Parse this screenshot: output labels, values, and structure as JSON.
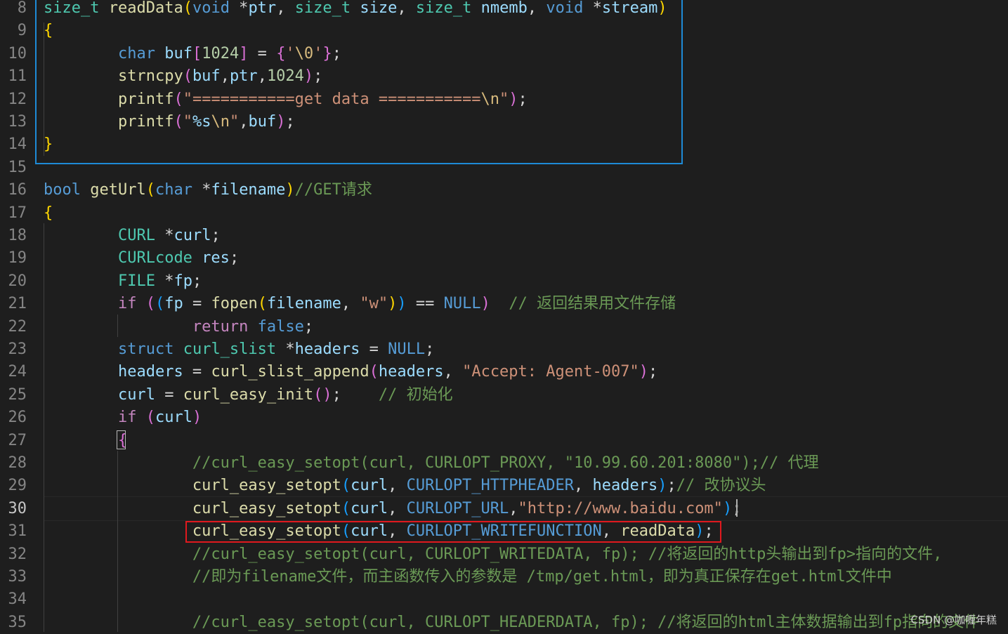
{
  "editor": {
    "active_line": "30",
    "lines": [
      {
        "n": "8",
        "tokens": [
          [
            "size_t",
            "ty"
          ],
          [
            " ",
            "pl"
          ],
          [
            "readData",
            "fn"
          ],
          [
            "(",
            "b1"
          ],
          [
            "void",
            "kw"
          ],
          [
            " *",
            "pl"
          ],
          [
            "ptr",
            "va"
          ],
          [
            ", ",
            "pl"
          ],
          [
            "size_t",
            "ty"
          ],
          [
            " ",
            "pl"
          ],
          [
            "size",
            "va"
          ],
          [
            ", ",
            "pl"
          ],
          [
            "size_t",
            "ty"
          ],
          [
            " ",
            "pl"
          ],
          [
            "nmemb",
            "va"
          ],
          [
            ", ",
            "pl"
          ],
          [
            "void",
            "kw"
          ],
          [
            " *",
            "pl"
          ],
          [
            "stream",
            "va"
          ],
          [
            ")",
            "b1"
          ]
        ]
      },
      {
        "n": "9",
        "tokens": [
          [
            "{",
            "b1"
          ]
        ]
      },
      {
        "n": "10",
        "tokens": [
          [
            "        ",
            "pl"
          ],
          [
            "char",
            "kw"
          ],
          [
            " ",
            "pl"
          ],
          [
            "buf",
            "va"
          ],
          [
            "[",
            "b2"
          ],
          [
            "1024",
            "nu"
          ],
          [
            "]",
            "b2"
          ],
          [
            " = ",
            "pl"
          ],
          [
            "{",
            "b2"
          ],
          [
            "'",
            "st"
          ],
          [
            "\\0",
            "es"
          ],
          [
            "'",
            "st"
          ],
          [
            "}",
            "b2"
          ],
          [
            ";",
            "pl"
          ]
        ]
      },
      {
        "n": "11",
        "tokens": [
          [
            "        ",
            "pl"
          ],
          [
            "strncpy",
            "fn"
          ],
          [
            "(",
            "b2"
          ],
          [
            "buf",
            "va"
          ],
          [
            ",",
            "pl"
          ],
          [
            "ptr",
            "va"
          ],
          [
            ",",
            "pl"
          ],
          [
            "1024",
            "nu"
          ],
          [
            ")",
            "b2"
          ],
          [
            ";",
            "pl"
          ]
        ]
      },
      {
        "n": "12",
        "tokens": [
          [
            "        ",
            "pl"
          ],
          [
            "printf",
            "fn"
          ],
          [
            "(",
            "b2"
          ],
          [
            "\"===========get data ===========",
            "st"
          ],
          [
            "\\n",
            "es"
          ],
          [
            "\"",
            "st"
          ],
          [
            ")",
            "b2"
          ],
          [
            ";",
            "pl"
          ]
        ]
      },
      {
        "n": "13",
        "tokens": [
          [
            "        ",
            "pl"
          ],
          [
            "printf",
            "fn"
          ],
          [
            "(",
            "b2"
          ],
          [
            "\"",
            "st"
          ],
          [
            "%s",
            "va"
          ],
          [
            "\\n",
            "es"
          ],
          [
            "\"",
            "st"
          ],
          [
            ",",
            "pl"
          ],
          [
            "buf",
            "va"
          ],
          [
            ")",
            "b2"
          ],
          [
            ";",
            "pl"
          ]
        ]
      },
      {
        "n": "14",
        "tokens": [
          [
            "}",
            "b1"
          ]
        ]
      },
      {
        "n": "15",
        "tokens": []
      },
      {
        "n": "16",
        "tokens": [
          [
            "bool",
            "kw"
          ],
          [
            " ",
            "pl"
          ],
          [
            "getUrl",
            "fn"
          ],
          [
            "(",
            "b1"
          ],
          [
            "char",
            "kw"
          ],
          [
            " *",
            "pl"
          ],
          [
            "filename",
            "va"
          ],
          [
            ")",
            "b1"
          ],
          [
            "//GET请求",
            "cm"
          ]
        ]
      },
      {
        "n": "17",
        "tokens": [
          [
            "{",
            "b1"
          ]
        ]
      },
      {
        "n": "18",
        "tokens": [
          [
            "        ",
            "pl"
          ],
          [
            "CURL",
            "ty"
          ],
          [
            " *",
            "pl"
          ],
          [
            "curl",
            "va"
          ],
          [
            ";",
            "pl"
          ]
        ]
      },
      {
        "n": "19",
        "tokens": [
          [
            "        ",
            "pl"
          ],
          [
            "CURLcode",
            "ty"
          ],
          [
            " ",
            "pl"
          ],
          [
            "res",
            "va"
          ],
          [
            ";",
            "pl"
          ]
        ]
      },
      {
        "n": "20",
        "tokens": [
          [
            "        ",
            "pl"
          ],
          [
            "FILE",
            "ty"
          ],
          [
            " *",
            "pl"
          ],
          [
            "fp",
            "va"
          ],
          [
            ";",
            "pl"
          ]
        ]
      },
      {
        "n": "21",
        "tokens": [
          [
            "        ",
            "pl"
          ],
          [
            "if",
            "ctl"
          ],
          [
            " ",
            "pl"
          ],
          [
            "(",
            "b2"
          ],
          [
            "(",
            "b3"
          ],
          [
            "fp",
            "va"
          ],
          [
            " = ",
            "pl"
          ],
          [
            "fopen",
            "fn"
          ],
          [
            "(",
            "b1"
          ],
          [
            "filename",
            "va"
          ],
          [
            ", ",
            "pl"
          ],
          [
            "\"w\"",
            "st"
          ],
          [
            ")",
            "b1"
          ],
          [
            ")",
            "b3"
          ],
          [
            " == ",
            "pl"
          ],
          [
            "NULL",
            "ma"
          ],
          [
            ")",
            "b2"
          ],
          [
            "  ",
            "pl"
          ],
          [
            "// 返回结果用文件存储",
            "cm"
          ]
        ]
      },
      {
        "n": "22",
        "tokens": [
          [
            "                ",
            "pl"
          ],
          [
            "return",
            "ctl"
          ],
          [
            " ",
            "pl"
          ],
          [
            "false",
            "kw"
          ],
          [
            ";",
            "pl"
          ]
        ]
      },
      {
        "n": "23",
        "tokens": [
          [
            "        ",
            "pl"
          ],
          [
            "struct",
            "kw"
          ],
          [
            " ",
            "pl"
          ],
          [
            "curl_slist",
            "ty"
          ],
          [
            " *",
            "pl"
          ],
          [
            "headers",
            "va"
          ],
          [
            " = ",
            "pl"
          ],
          [
            "NULL",
            "ma"
          ],
          [
            ";",
            "pl"
          ]
        ]
      },
      {
        "n": "24",
        "tokens": [
          [
            "        ",
            "pl"
          ],
          [
            "headers",
            "va"
          ],
          [
            " = ",
            "pl"
          ],
          [
            "curl_slist_append",
            "fn"
          ],
          [
            "(",
            "b2"
          ],
          [
            "headers",
            "va"
          ],
          [
            ", ",
            "pl"
          ],
          [
            "\"Accept: Agent-007\"",
            "st"
          ],
          [
            ")",
            "b2"
          ],
          [
            ";",
            "pl"
          ]
        ]
      },
      {
        "n": "25",
        "tokens": [
          [
            "        ",
            "pl"
          ],
          [
            "curl",
            "va"
          ],
          [
            " = ",
            "pl"
          ],
          [
            "curl_easy_init",
            "fn"
          ],
          [
            "(",
            "b2"
          ],
          [
            ")",
            "b2"
          ],
          [
            ";",
            "pl"
          ],
          [
            "    ",
            "pl"
          ],
          [
            "// 初始化",
            "cm"
          ]
        ]
      },
      {
        "n": "26",
        "tokens": [
          [
            "        ",
            "pl"
          ],
          [
            "if",
            "ctl"
          ],
          [
            " ",
            "pl"
          ],
          [
            "(",
            "b2"
          ],
          [
            "curl",
            "va"
          ],
          [
            ")",
            "b2"
          ]
        ]
      },
      {
        "n": "27",
        "tokens": [
          [
            "        ",
            "pl"
          ],
          [
            "{",
            "b2"
          ]
        ]
      },
      {
        "n": "28",
        "tokens": [
          [
            "                ",
            "pl"
          ],
          [
            "//curl_easy_setopt(curl, CURLOPT_PROXY, \"10.99.60.201:8080\");// 代理",
            "cm"
          ]
        ]
      },
      {
        "n": "29",
        "tokens": [
          [
            "                ",
            "pl"
          ],
          [
            "curl_easy_setopt",
            "fn"
          ],
          [
            "(",
            "b3"
          ],
          [
            "curl",
            "va"
          ],
          [
            ", ",
            "pl"
          ],
          [
            "CURLOPT_HTTPHEADER",
            "ma"
          ],
          [
            ", ",
            "pl"
          ],
          [
            "headers",
            "va"
          ],
          [
            ")",
            "b3"
          ],
          [
            ";",
            "pl"
          ],
          [
            "// 改协议头",
            "cm"
          ]
        ]
      },
      {
        "n": "30",
        "tokens": [
          [
            "                ",
            "pl"
          ],
          [
            "curl_easy_setopt",
            "fn"
          ],
          [
            "(",
            "b3"
          ],
          [
            "curl",
            "va"
          ],
          [
            ", ",
            "pl"
          ],
          [
            "CURLOPT_URL",
            "ma"
          ],
          [
            ",",
            "pl"
          ],
          [
            "\"http://www.baidu.com\"",
            "st"
          ],
          [
            ")",
            "b3"
          ],
          [
            ";",
            "pl"
          ]
        ]
      },
      {
        "n": "31",
        "tokens": [
          [
            "                ",
            "pl"
          ],
          [
            "curl_easy_setopt",
            "fn"
          ],
          [
            "(",
            "b3"
          ],
          [
            "curl",
            "va"
          ],
          [
            ", ",
            "pl"
          ],
          [
            "CURLOPT_WRITEFUNCTION",
            "ma"
          ],
          [
            ", ",
            "pl"
          ],
          [
            "readData",
            "fn"
          ],
          [
            ")",
            "b3"
          ],
          [
            ";",
            "pl"
          ]
        ]
      },
      {
        "n": "32",
        "tokens": [
          [
            "                ",
            "pl"
          ],
          [
            "//curl_easy_setopt(curl, CURLOPT_WRITEDATA, fp); //将返回的http头输出到fp>指向的文件,",
            "cm"
          ]
        ]
      },
      {
        "n": "33",
        "tokens": [
          [
            "                ",
            "pl"
          ],
          [
            "//即为filename文件，而主函数传入的参数是 /tmp/get.html，即为真正保存在get.html文件中",
            "cm"
          ]
        ]
      },
      {
        "n": "34",
        "tokens": []
      },
      {
        "n": "35",
        "tokens": [
          [
            "                ",
            "pl"
          ],
          [
            "//curl_easy_setopt(curl, CURLOPT_HEADERDATA, fp); //将返回的html主体数据输出到fp指向的文件",
            "cm"
          ]
        ]
      }
    ]
  },
  "watermark": "CSDN @咖喱年糕"
}
